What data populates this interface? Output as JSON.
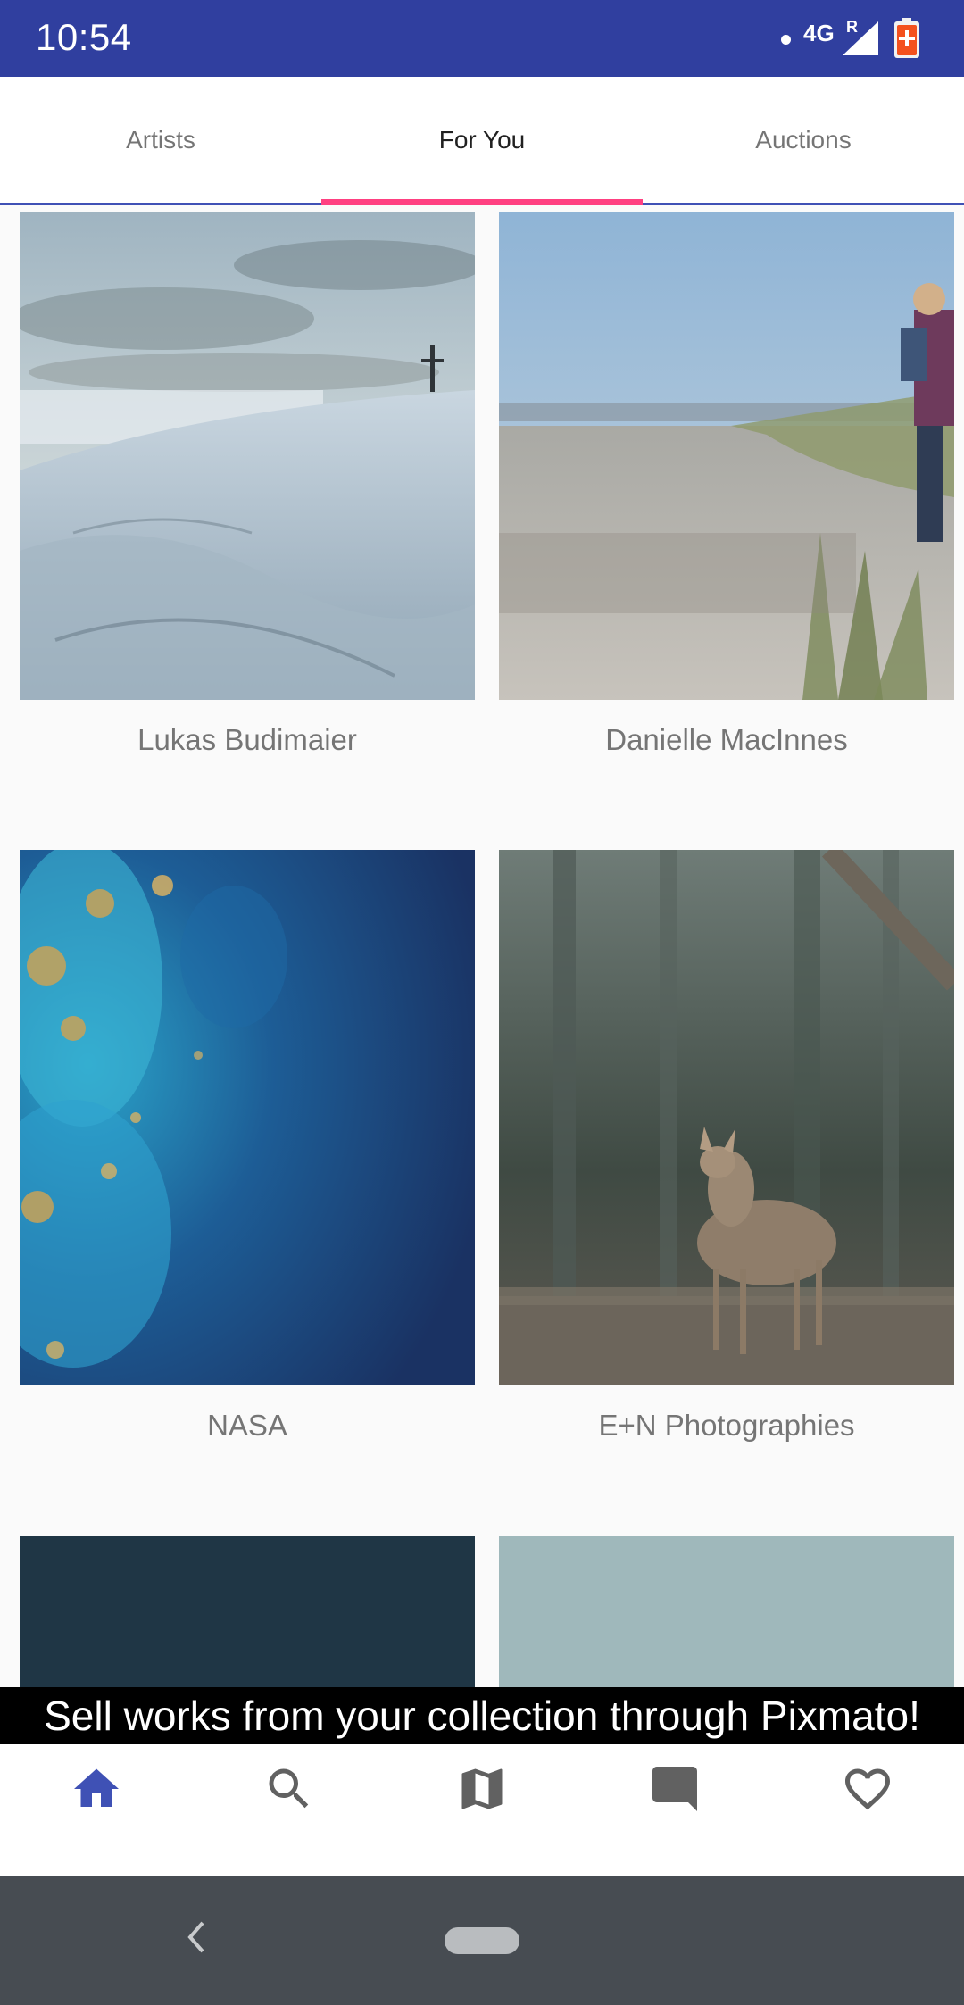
{
  "status_bar": {
    "time": "10:54",
    "network": "4G",
    "roaming": "R",
    "icons": [
      "notification-dot-icon",
      "signal-icon",
      "battery-charging-icon"
    ]
  },
  "tabs": [
    {
      "label": "Artists",
      "active": false
    },
    {
      "label": "For You",
      "active": true
    },
    {
      "label": "Auctions",
      "active": false
    }
  ],
  "grid": {
    "items": [
      {
        "caption": "Lukas Budimaier",
        "image": "snowy mountain with cross"
      },
      {
        "caption": "Danielle MacInnes",
        "image": "beach path with person carrying child"
      },
      {
        "caption": "NASA",
        "image": "blue ocean with algae bloom from space"
      },
      {
        "caption": "E+N Photographies",
        "image": "fawn deer in forest"
      },
      {
        "caption": "",
        "image": "dark teal abstract"
      },
      {
        "caption": "",
        "image": "portrait against pale sky"
      }
    ]
  },
  "banner": {
    "text": "Sell works from your collection through Pixmato!"
  },
  "bottom_nav": {
    "items": [
      {
        "icon": "home-icon",
        "active": true
      },
      {
        "icon": "search-icon",
        "active": false
      },
      {
        "icon": "map-icon",
        "active": false
      },
      {
        "icon": "chat-icon",
        "active": false
      },
      {
        "icon": "heart-icon",
        "active": false
      }
    ]
  },
  "colors": {
    "primary_dark": "#303f9f",
    "primary": "#3f51b5",
    "accent": "#ff4081",
    "caption": "#757575",
    "nav_icon_inactive": "#616161",
    "system_nav": "#474c52"
  }
}
